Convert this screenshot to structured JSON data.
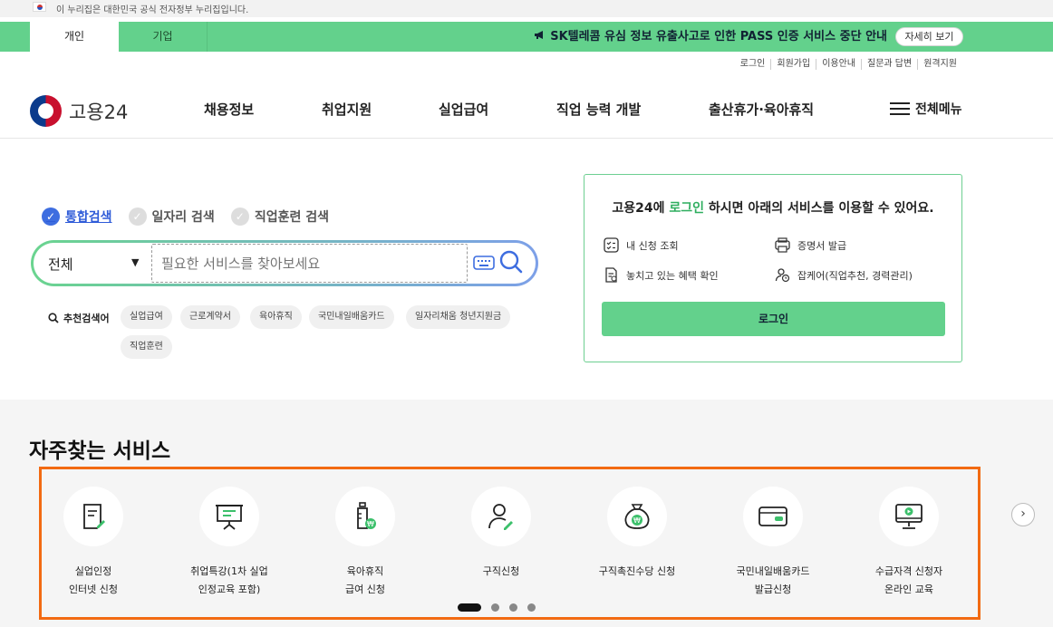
{
  "gov_bar": {
    "text": "이 누리집은 대한민국 공식 전자정부 누리집입니다."
  },
  "tabs": [
    {
      "label": "개인",
      "active": true
    },
    {
      "label": "기업",
      "active": false
    }
  ],
  "notice": {
    "message": "SK텔레콤 유심 정보 유출사고로 인한 PASS 인증 서비스 중단 안내",
    "button": "자세히 보기",
    "icon": "megaphone-icon",
    "color": "#63d18c"
  },
  "util_links": [
    "로그인",
    "회원가입",
    "이용안내",
    "질문과 답변",
    "원격지원"
  ],
  "header": {
    "logo": "고용24",
    "nav": [
      "채용정보",
      "취업지원",
      "실업급여",
      "직업 능력 개발",
      "출산휴가·육아휴직"
    ],
    "all_menu": "전체메뉴"
  },
  "search": {
    "types": [
      {
        "label": "통합검색",
        "active": true
      },
      {
        "label": "일자리 검색",
        "active": false
      },
      {
        "label": "직업훈련 검색",
        "active": false
      }
    ],
    "category": "전체",
    "placeholder": "필요한 서비스를 찾아보세요",
    "recommend_label": "추천검색어",
    "chips": [
      "실업급여",
      "근로계약서",
      "육아휴직",
      "국민내일배움카드",
      "일자리채움 청년지원금",
      "직업훈련"
    ]
  },
  "login_card": {
    "title_pre": "고용24에 ",
    "title_hl": "로그인",
    "title_post": " 하시면 아래의 서비스를 이용할 수 있어요.",
    "services": [
      "내 신청 조회",
      "증명서 발급",
      "놓치고 있는 혜택 확인",
      "잡케어(직업추천, 경력관리)"
    ],
    "button": "로그인"
  },
  "faq": {
    "title": "자주찾는 서비스",
    "items": [
      {
        "line1": "실업인정",
        "line2": "인터넷 신청",
        "icon": "document-pen-icon"
      },
      {
        "line1": "취업특강(1차 실업",
        "line2": "인정교육 포함)",
        "icon": "presentation-board-icon"
      },
      {
        "line1": "육아휴직",
        "line2": "급여 신청",
        "icon": "baby-bottle-icon"
      },
      {
        "line1": "구직신청",
        "line2": "",
        "icon": "person-pen-icon"
      },
      {
        "line1": "구직촉진수당 신청",
        "line2": "",
        "icon": "money-bag-icon"
      },
      {
        "line1": "국민내일배움카드",
        "line2": "발급신청",
        "icon": "card-icon"
      },
      {
        "line1": "수급자격 신청자",
        "line2": "온라인 교육",
        "icon": "monitor-play-icon"
      }
    ],
    "page_dots": 4,
    "active_dot": 1
  },
  "colors": {
    "accent": "#63d18c",
    "highlight_frame": "#f26a12",
    "link_blue": "#2e5bd8"
  }
}
